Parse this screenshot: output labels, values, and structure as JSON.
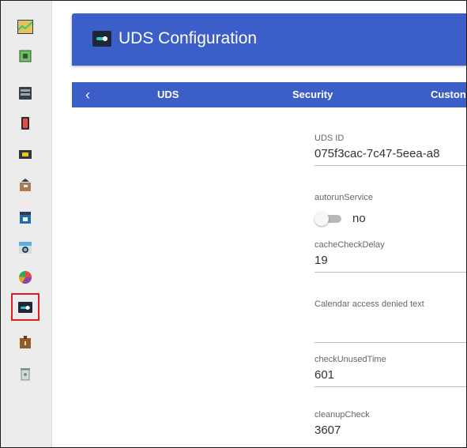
{
  "header": {
    "title": "UDS Configuration",
    "icon": "uds-toggle-icon"
  },
  "tabs": {
    "back_icon": "‹",
    "items": [
      {
        "label": "UDS",
        "active": true
      },
      {
        "label": "Security",
        "active": false
      },
      {
        "label": "Custon",
        "active": false
      }
    ]
  },
  "fields": {
    "uds_id": {
      "label": "UDS ID",
      "value": "075f3cac-7c47-5eea-a8"
    },
    "autorun": {
      "label": "autorunService",
      "value": "no"
    },
    "cache_check_delay": {
      "label": "cacheCheckDelay",
      "value": "19"
    },
    "calendar_denied": {
      "label": "Calendar access denied text",
      "value": ""
    },
    "check_unused_time": {
      "label": "checkUnusedTime",
      "value": "601"
    },
    "cleanup_check": {
      "label": "cleanupCheck",
      "value": "3607"
    }
  },
  "sidebar": {
    "items": [
      {
        "icon": "dashboard-chart-icon"
      },
      {
        "icon": "chip-icon"
      },
      {
        "icon": "server-icon"
      },
      {
        "icon": "red-device-icon"
      },
      {
        "icon": "network-adapter-icon"
      },
      {
        "icon": "package-icon"
      },
      {
        "icon": "calendar-icon"
      },
      {
        "icon": "camera-icon"
      },
      {
        "icon": "pie-chart-icon"
      },
      {
        "icon": "uds-toggle-icon",
        "selected": true
      },
      {
        "icon": "briefcase-icon"
      },
      {
        "icon": "trash-icon"
      }
    ]
  },
  "colors": {
    "header_bg": "#3b5ec8",
    "tab_bar_bg": "#3b5ec8",
    "selection_outline": "#e11d22",
    "sidebar_bg": "#ececec"
  }
}
